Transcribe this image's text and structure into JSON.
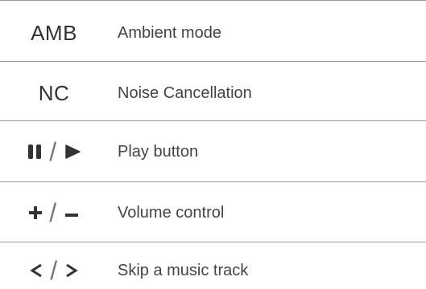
{
  "rows": [
    {
      "symbol": "AMB",
      "label": "Ambient mode"
    },
    {
      "symbol": "NC",
      "label": "Noise Cancellation"
    },
    {
      "symbol_separator": "/",
      "label": "Play button"
    },
    {
      "symbol_separator": "/",
      "label": "Volume control"
    },
    {
      "symbol_separator": "/",
      "label": "Skip a music track"
    }
  ],
  "icons": {
    "row3": [
      "pause-icon",
      "play-icon"
    ],
    "row4": [
      "plus-icon",
      "minus-icon"
    ],
    "row5": [
      "chevron-left-icon",
      "chevron-right-icon"
    ]
  },
  "colors": {
    "text": "#333333",
    "rule": "#9a9a9a",
    "icon": "#333333"
  }
}
